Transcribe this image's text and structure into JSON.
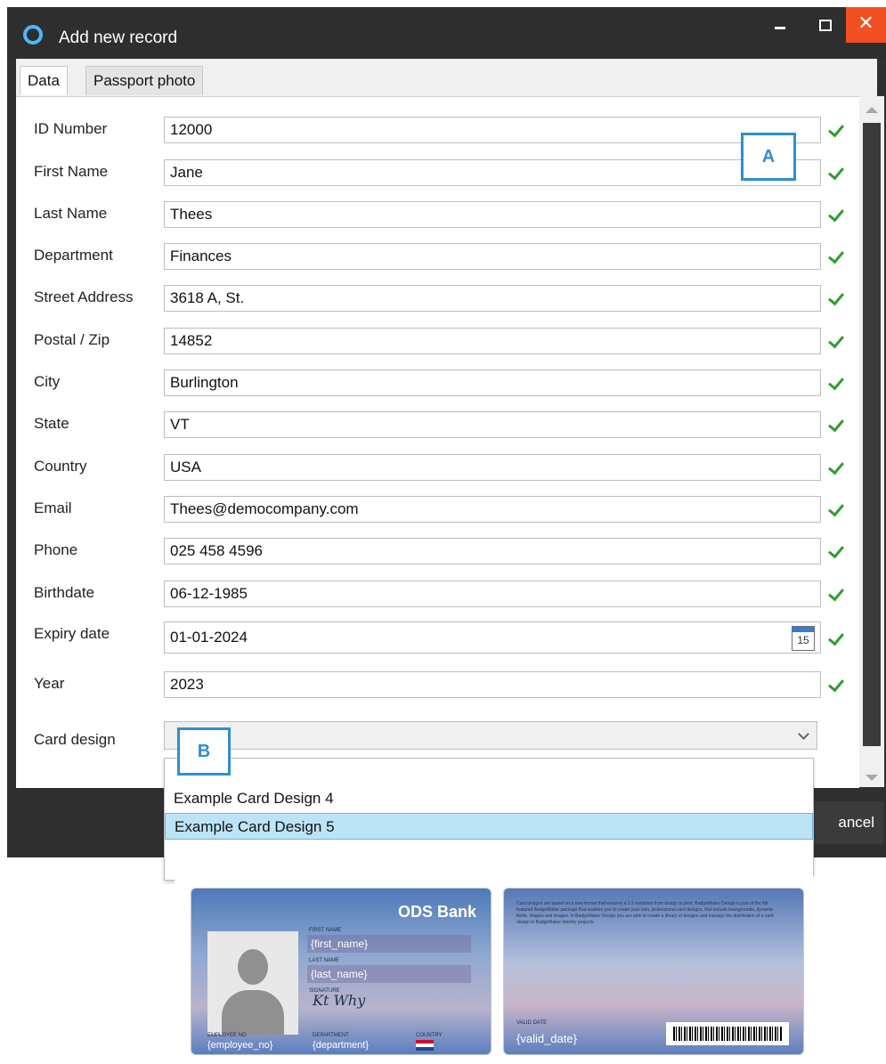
{
  "window": {
    "title": "Add new record",
    "close_glyph": "✕"
  },
  "tabs": {
    "data": "Data",
    "passport_photo": "Passport photo"
  },
  "fields": [
    {
      "label": "ID Number",
      "value": "12000"
    },
    {
      "label": "First Name",
      "value": "Jane"
    },
    {
      "label": "Last Name",
      "value": "Thees"
    },
    {
      "label": "Department",
      "value": "Finances"
    },
    {
      "label": "Street Address",
      "value": "3618 A, St."
    },
    {
      "label": "Postal / Zip",
      "value": "14852"
    },
    {
      "label": "City",
      "value": "Burlington"
    },
    {
      "label": "State",
      "value": "VT"
    },
    {
      "label": "Country",
      "value": "USA"
    },
    {
      "label": "Email",
      "value": "Thees@democompany.com"
    },
    {
      "label": "Phone",
      "value": "025 458 4596"
    },
    {
      "label": "Birthdate",
      "value": "06-12-1985"
    },
    {
      "label": "Expiry date",
      "value": "01-01-2024",
      "calendar_icon_text": "15"
    },
    {
      "label": "Year",
      "value": "2023"
    }
  ],
  "card_design": {
    "label": "Card design",
    "selected_value": "",
    "options": [
      "Example Card Design 4",
      "Example Card Design 5"
    ],
    "highlighted_option": "Example Card Design 5"
  },
  "buttons": {
    "cancel_partial": "ancel"
  },
  "markers": {
    "a": "A",
    "b": "B"
  },
  "card_preview": {
    "bank_name": "ODS Bank",
    "first_name_label": "FIRST NAME",
    "first_name_value": "{first_name}",
    "last_name_label": "LAST NAME",
    "last_name_value": "{last_name}",
    "signature_label": "SIGNATURE",
    "employee_no_label": "EMPLOYEE NO",
    "employee_no_value": "{employee_no}",
    "department_label": "DEPARTMENT",
    "department_value": "{department}",
    "country_label": "COUNTRY",
    "back_text": "Card designs are based on a new format that ensures a 1:1 transition from design to print. BadgeMaker Design is part of the full featured BadgeMaker package that enables you to create your own, professional card designs, that include backgrounds, dynamic fields, shapes and images. In BadgeMaker Design you are able to create a library of designs and manage the distribution of a card design to BadgeMaker Identity projects.",
    "valid_date_label": "VALID DATE",
    "valid_date_value": "{valid_date}"
  },
  "colors": {
    "accent": "#2f8fce",
    "check": "#2e9e2e",
    "close_button": "#f25022",
    "selection": "#bde3f7"
  }
}
